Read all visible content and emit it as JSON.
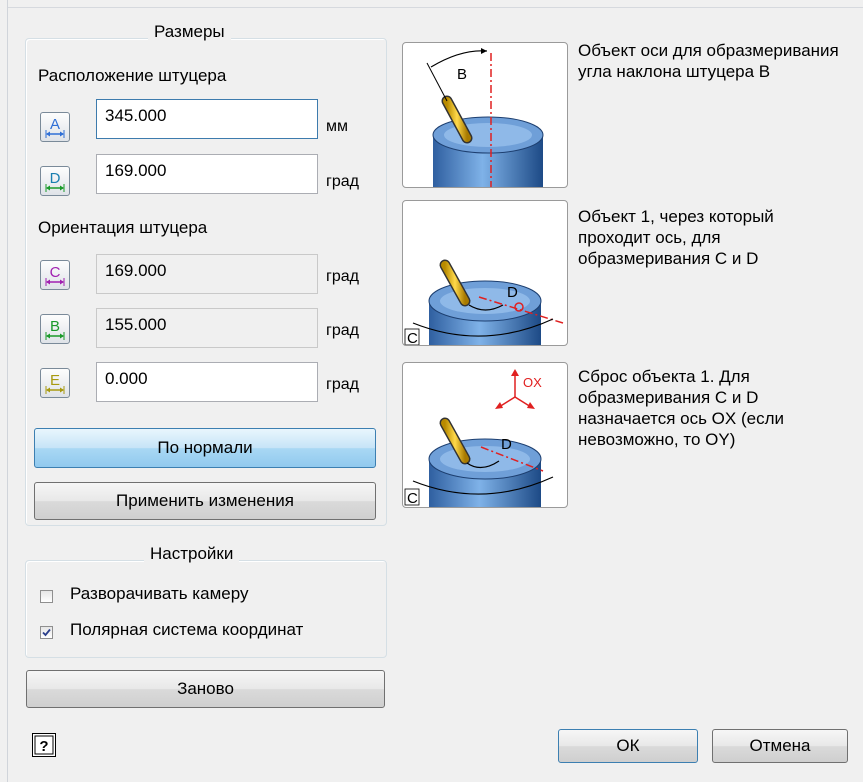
{
  "dimensions": {
    "title": "Размеры",
    "position_title": "Расположение штуцера",
    "fields": [
      {
        "letter": "A",
        "value": "345.000",
        "unit": "мм",
        "color": "#2f6fd6",
        "editable": true
      },
      {
        "letter": "D",
        "value": "169.000",
        "unit": "град",
        "color": "#1a7fb0",
        "editable": true
      }
    ],
    "orientation_title": "Ориентация штуцера",
    "orientation_fields": [
      {
        "letter": "C",
        "value": "169.000",
        "unit": "град",
        "color": "#a020b0",
        "editable": false
      },
      {
        "letter": "B",
        "value": "155.000",
        "unit": "град",
        "color": "#1a9a2a",
        "editable": false
      },
      {
        "letter": "E",
        "value": "0.000",
        "unit": "град",
        "color": "#a89a10",
        "editable": true
      }
    ],
    "normal_button": "По нормали",
    "apply_button": "Применить изменения"
  },
  "settings": {
    "title": "Настройки",
    "checkboxes": [
      {
        "label": "Разворачивать камеру",
        "checked": false
      },
      {
        "label": "Полярная система координат",
        "checked": true
      }
    ]
  },
  "reset_button": "Заново",
  "help_icon": "question-mark-icon",
  "ok_button": "ОК",
  "cancel_button": "Отмена",
  "pictures": [
    {
      "description": "Объект оси для образмеривания угла наклона штуцера B",
      "labels": [
        "B"
      ]
    },
    {
      "description": "Объект 1, через который проходит ось, для образмеривания  C и D",
      "labels": [
        "D",
        "C"
      ]
    },
    {
      "description": "Сброс объекта 1. Для образмеривания  C и D назначается ось OX (если невозможно, то OY)",
      "labels": [
        "OX",
        "D",
        "C"
      ]
    }
  ]
}
